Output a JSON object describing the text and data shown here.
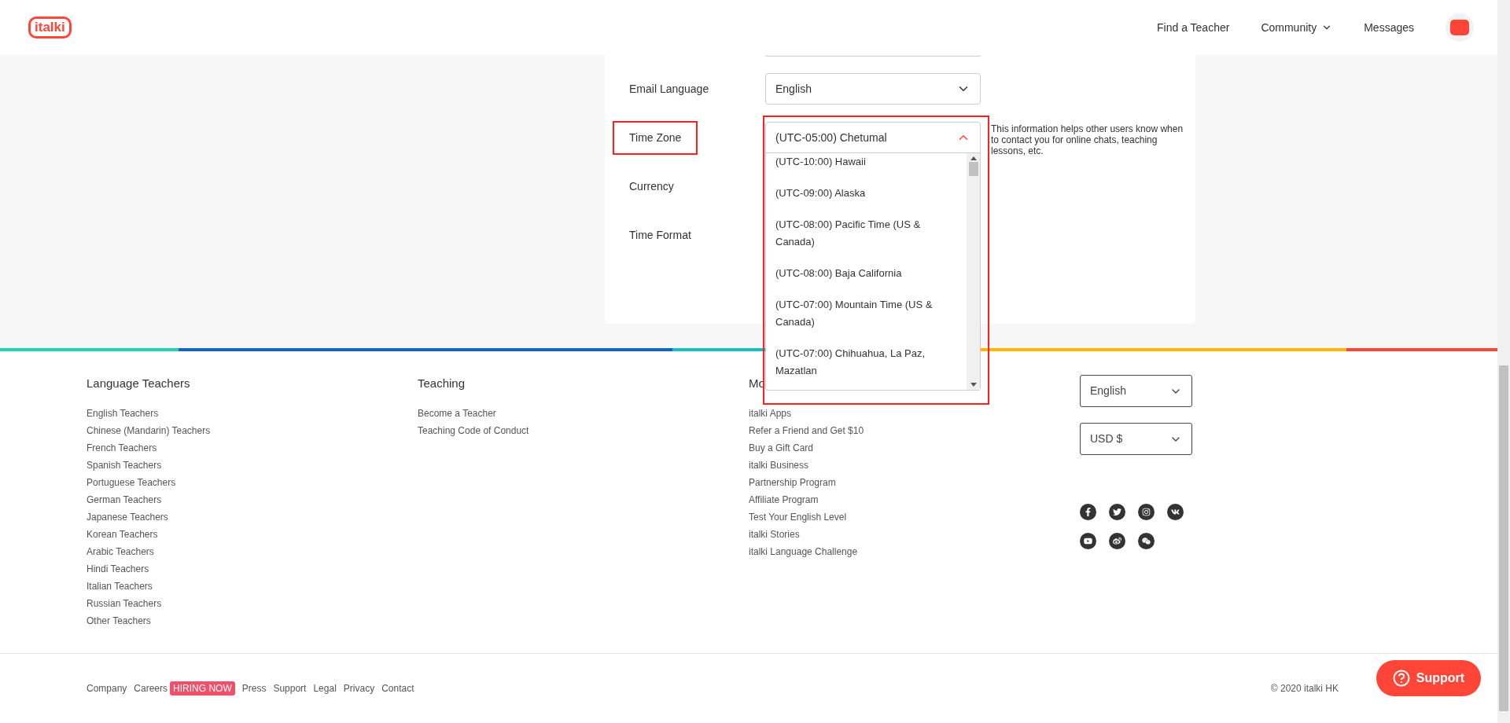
{
  "header": {
    "logo": "italki",
    "nav": [
      {
        "label": "Find a Teacher",
        "has_menu": false
      },
      {
        "label": "Community",
        "has_menu": true
      },
      {
        "label": "Messages",
        "has_menu": false
      }
    ]
  },
  "settings": {
    "rows": [
      {
        "label": "Email Language",
        "highlighted": false,
        "select": {
          "value": "English",
          "expanded": false
        }
      },
      {
        "label": "Time Zone",
        "highlighted": true,
        "select": {
          "value": "(UTC-05:00) Chetumal",
          "expanded": true
        },
        "help": "This information helps other users know when to contact you for online chats, teaching lessons, etc."
      },
      {
        "label": "Currency",
        "highlighted": false
      },
      {
        "label": "Time Format",
        "highlighted": false
      }
    ],
    "dropdown": {
      "highlighted": true,
      "options": [
        "(UTC-10:00) Hawaii",
        "(UTC-09:00) Alaska",
        "(UTC-08:00) Pacific Time (US & Canada)",
        "(UTC-08:00) Baja California",
        "(UTC-07:00) Mountain Time (US & Canada)",
        "(UTC-07:00) Chihuahua, La Paz, Mazatlan"
      ]
    }
  },
  "footer": {
    "columns": [
      {
        "heading": "Language Teachers",
        "links": [
          "English Teachers",
          "Chinese (Mandarin) Teachers",
          "French Teachers",
          "Spanish Teachers",
          "Portuguese Teachers",
          "German Teachers",
          "Japanese Teachers",
          "Korean Teachers",
          "Arabic Teachers",
          "Hindi Teachers",
          "Italian Teachers",
          "Russian Teachers",
          "Other Teachers"
        ]
      },
      {
        "heading": "Teaching",
        "links": [
          "Become a Teacher",
          "Teaching Code of Conduct"
        ]
      },
      {
        "heading": "Mo",
        "links": [
          "italki Apps",
          "Refer a Friend and Get $10",
          "Buy a Gift Card",
          "italki Business",
          "Partnership Program",
          "Affiliate Program",
          "Test Your English Level",
          "italki Stories",
          "italki Language Challenge"
        ]
      }
    ],
    "selects": [
      "English",
      "USD $"
    ],
    "bottom_links": [
      {
        "label": "Company"
      },
      {
        "label": "Careers",
        "badge": "HIRING NOW"
      },
      {
        "label": "Press"
      },
      {
        "label": "Support"
      },
      {
        "label": "Legal"
      },
      {
        "label": "Privacy"
      },
      {
        "label": "Contact"
      }
    ],
    "copyright": "© 2020 italki HK"
  },
  "support_button": "Support"
}
